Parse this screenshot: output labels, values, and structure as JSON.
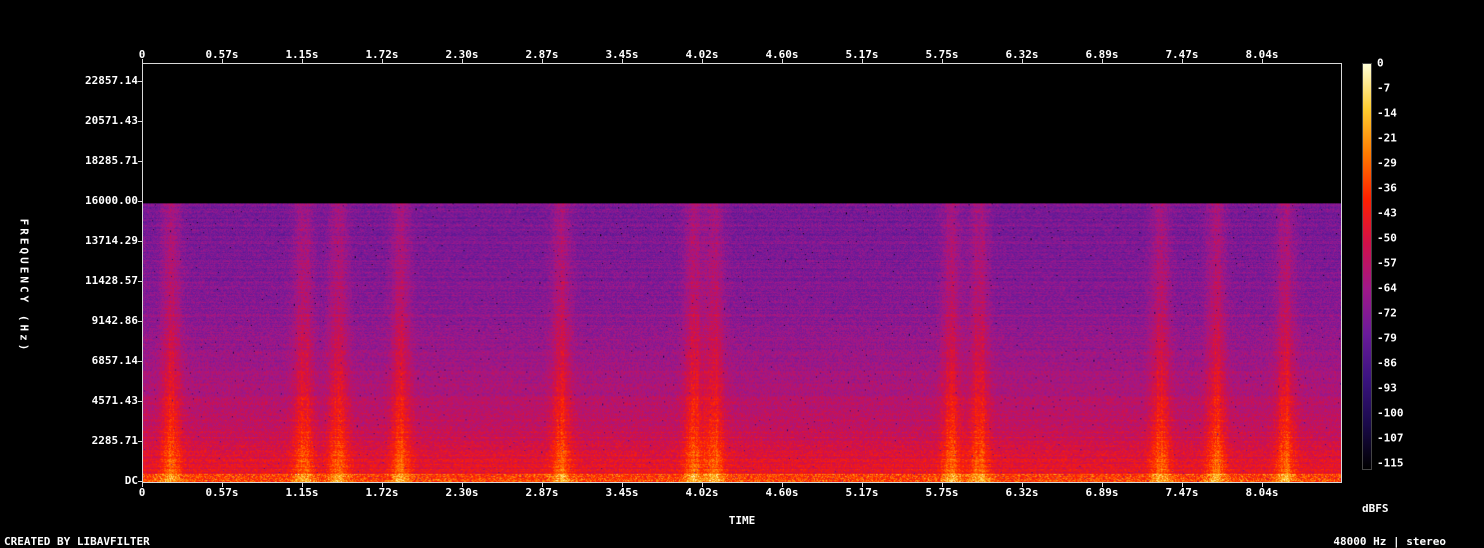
{
  "chart_data": {
    "type": "heatmap",
    "title": "",
    "xlabel": "TIME",
    "ylabel": "FREQUENCY (Hz)",
    "x_ticks": [
      "0",
      "0.57s",
      "1.15s",
      "1.72s",
      "2.30s",
      "2.87s",
      "3.45s",
      "4.02s",
      "4.60s",
      "5.17s",
      "5.75s",
      "6.32s",
      "6.89s",
      "7.47s",
      "8.04s"
    ],
    "y_ticks": [
      "DC",
      "2285.71",
      "4571.43",
      "6857.14",
      "9142.86",
      "11428.57",
      "13714.29",
      "16000.00",
      "18285.71",
      "20571.43",
      "22857.14"
    ],
    "xlim": [
      0,
      8.6
    ],
    "ylim": [
      0,
      24000
    ],
    "cutoff_hz": 16000,
    "colorbar": {
      "unit": "dBFS",
      "ticks": [
        "0",
        "-7",
        "-14",
        "-21",
        "-29",
        "-36",
        "-43",
        "-50",
        "-57",
        "-64",
        "-72",
        "-79",
        "-86",
        "-93",
        "-100",
        "-107",
        "-115"
      ],
      "range": [
        -120,
        0
      ],
      "colors": [
        "#000000",
        "#1a0a4a",
        "#3a1380",
        "#6a1a9a",
        "#a0188a",
        "#d0104a",
        "#ff2000",
        "#ff7a00",
        "#ffcc30",
        "#ffffd8"
      ]
    },
    "loud_segments_s": [
      0.2,
      1.15,
      1.4,
      1.85,
      3.0,
      3.95,
      4.1,
      5.8,
      6.0,
      7.3,
      7.7,
      8.2
    ],
    "legend": "none",
    "grid": false
  },
  "footer": {
    "left": "CREATED BY LIBAVFILTER",
    "right": "48000 Hz | stereo"
  }
}
